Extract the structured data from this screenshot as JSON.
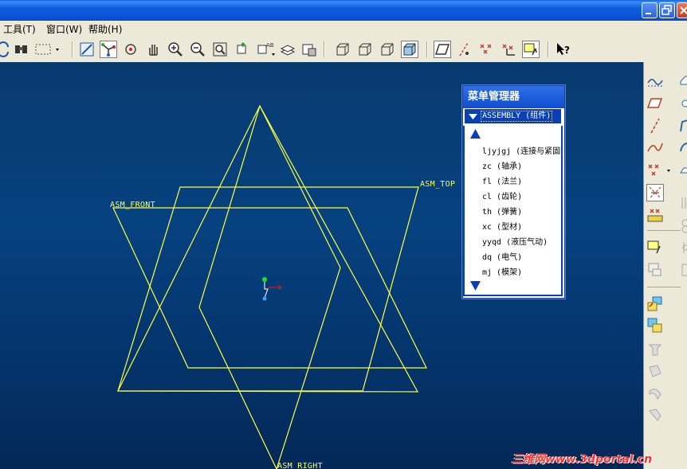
{
  "window": {
    "buttons": [
      "minimize-icon",
      "restore-icon",
      "close-icon"
    ]
  },
  "menubar": {
    "items": [
      {
        "label": "工具(T)"
      },
      {
        "label": "窗口(W)"
      },
      {
        "label": "帮助(H)"
      }
    ]
  },
  "toolbar": {
    "icons": [
      "regenerate-icon",
      "find-icon",
      "select-box-icon",
      "named-views-icon",
      "spin-center-icon",
      "orient-mode-icon",
      "pan-icon",
      "zoom-in-icon",
      "zoom-out-icon",
      "refit-icon",
      "reorient-icon",
      "saved-views-icon",
      "layers-icon",
      "view-manager-icon",
      "wireframe-icon",
      "hidden-line-icon",
      "no-hidden-icon",
      "shading-icon",
      "datum-planes-icon",
      "datum-axes-icon",
      "datum-points-icon",
      "coordinate-systems-icon",
      "annotation-display-icon",
      "context-help-icon"
    ]
  },
  "model": {
    "datum_planes": [
      {
        "name": "ASM_FRONT"
      },
      {
        "name": "ASM_TOP"
      },
      {
        "name": "ASM_RIGHT"
      }
    ]
  },
  "menu_manager": {
    "title": "菜单管理器",
    "header": "ASSEMBLY (组件)",
    "items": [
      {
        "label": "ljyjgj (连接与紧固"
      },
      {
        "label": "zc (轴承)"
      },
      {
        "label": "fl (法兰)"
      },
      {
        "label": "cl (齿轮)"
      },
      {
        "label": "th (弹簧)"
      },
      {
        "label": "xc (型材)"
      },
      {
        "label": "yyqd (液压气动)"
      },
      {
        "label": "dq (电气)"
      },
      {
        "label": "mj (模架)"
      }
    ]
  },
  "watermark": {
    "text": "三维网www.3dportal.cn",
    "color": "#ff2e2e"
  },
  "colors": {
    "datum_plane": "#ffff40",
    "viewport_top": "#083a70",
    "viewport_bottom": "#032856",
    "menu_title_bg": "#0e4ed0"
  }
}
